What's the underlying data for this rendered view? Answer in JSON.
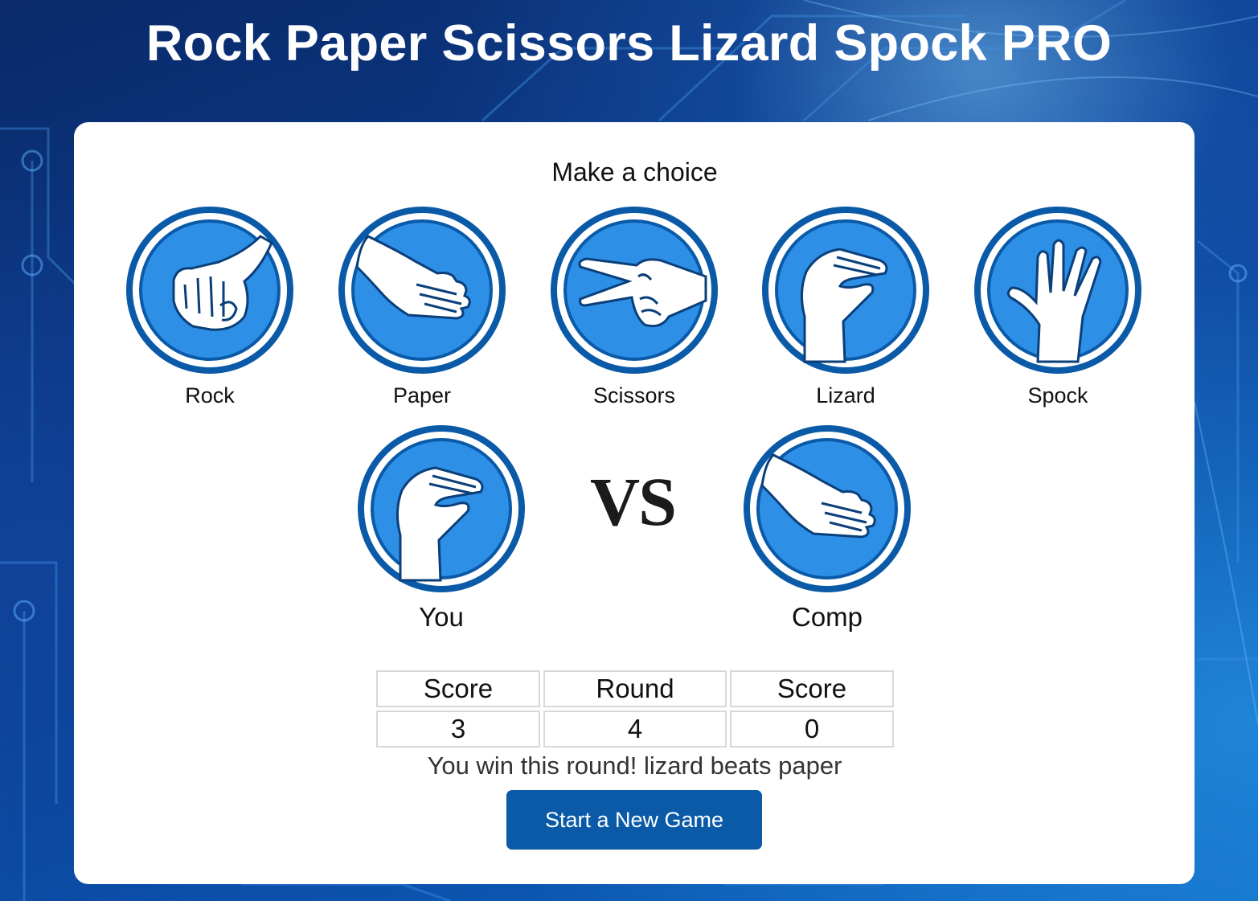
{
  "title": "Rock Paper Scissors Lizard Spock PRO",
  "prompt": "Make a choice",
  "choices": [
    {
      "label": "Rock",
      "icon": "rock-hand-icon"
    },
    {
      "label": "Paper",
      "icon": "paper-hand-icon"
    },
    {
      "label": "Scissors",
      "icon": "scissors-hand-icon"
    },
    {
      "label": "Lizard",
      "icon": "lizard-hand-icon"
    },
    {
      "label": "Spock",
      "icon": "spock-hand-icon"
    }
  ],
  "match": {
    "you_label": "You",
    "you_choice_icon": "lizard-hand-icon",
    "vs": "VS",
    "comp_label": "Comp",
    "comp_choice_icon": "paper-hand-icon"
  },
  "scoreboard": {
    "headers": [
      "Score",
      "Round",
      "Score"
    ],
    "values": [
      "3",
      "4",
      "0"
    ]
  },
  "result_message": "You win this round! lizard beats paper",
  "new_game_label": "Start a New Game",
  "colors": {
    "accent": "#0a5aa8",
    "icon_ring": "#0a5aa8",
    "icon_fill": "#2e8fe6",
    "card": "#ffffff"
  }
}
